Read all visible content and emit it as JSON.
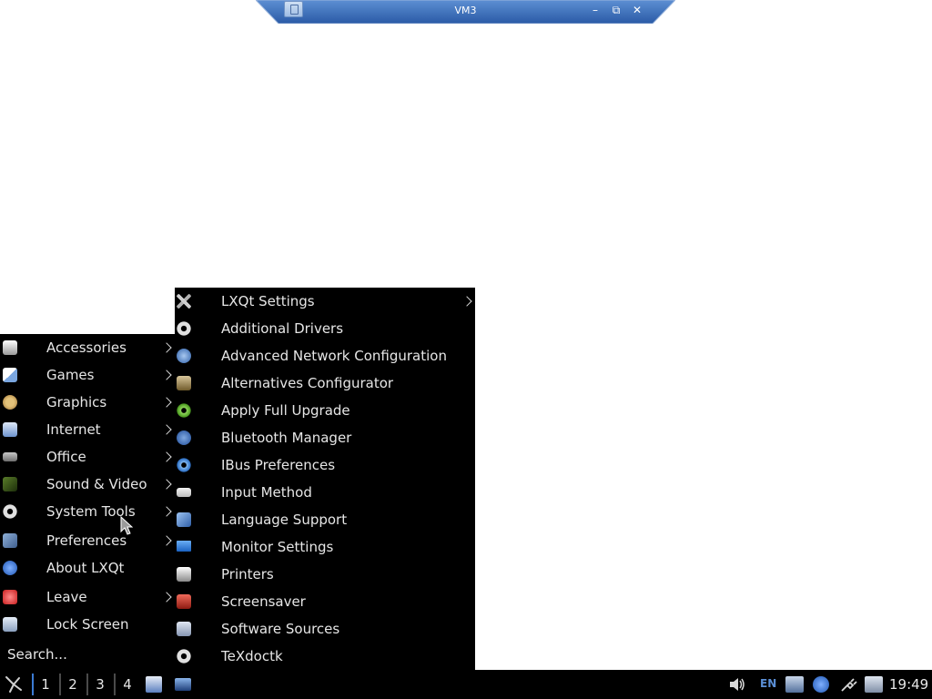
{
  "remote_bar": {
    "title": "VM3",
    "minimize": "–",
    "restore": "⧉",
    "close": "✕"
  },
  "main_menu": {
    "items": [
      {
        "label": "Accessories",
        "icon": "accessories-icon",
        "submenu": true
      },
      {
        "label": "Games",
        "icon": "games-icon",
        "submenu": true
      },
      {
        "label": "Graphics",
        "icon": "graphics-icon",
        "submenu": true
      },
      {
        "label": "Internet",
        "icon": "internet-icon",
        "submenu": true
      },
      {
        "label": "Office",
        "icon": "office-icon",
        "submenu": true
      },
      {
        "label": "Sound & Video",
        "icon": "sound-video-icon",
        "submenu": true
      },
      {
        "label": "System Tools",
        "icon": "gear-icon",
        "submenu": true
      },
      {
        "label": "Preferences",
        "icon": "preferences-icon",
        "submenu": true
      },
      {
        "label": "About LXQt",
        "icon": "info-icon",
        "submenu": false
      },
      {
        "label": "Leave",
        "icon": "power-icon",
        "submenu": true
      },
      {
        "label": "Lock Screen",
        "icon": "lock-icon",
        "submenu": false
      }
    ],
    "search_placeholder": "Search..."
  },
  "sub_menu": {
    "items": [
      {
        "label": "LXQt Settings",
        "icon": "tools-icon",
        "submenu": true
      },
      {
        "label": "Additional Drivers",
        "icon": "gear-icon",
        "submenu": false
      },
      {
        "label": "Advanced Network Configuration",
        "icon": "network-icon",
        "submenu": false
      },
      {
        "label": "Alternatives Configurator",
        "icon": "alternatives-icon",
        "submenu": false
      },
      {
        "label": "Apply Full Upgrade",
        "icon": "upgrade-gear-icon",
        "submenu": false
      },
      {
        "label": "Bluetooth Manager",
        "icon": "bluetooth-icon",
        "submenu": false
      },
      {
        "label": "IBus Preferences",
        "icon": "ibus-gear-icon",
        "submenu": false
      },
      {
        "label": "Input Method",
        "icon": "keyboard-icon",
        "submenu": false
      },
      {
        "label": "Language Support",
        "icon": "language-icon",
        "submenu": false
      },
      {
        "label": "Monitor Settings",
        "icon": "monitor-icon",
        "submenu": false
      },
      {
        "label": "Printers",
        "icon": "printer-icon",
        "submenu": false
      },
      {
        "label": "Screensaver",
        "icon": "screensaver-icon",
        "submenu": false
      },
      {
        "label": "Software Sources",
        "icon": "software-sources-icon",
        "submenu": false
      },
      {
        "label": "TeXdoctk",
        "icon": "gear-icon",
        "submenu": false
      }
    ]
  },
  "taskbar": {
    "desktops": [
      "1",
      "2",
      "3",
      "4"
    ],
    "active_desktop": "1",
    "keyboard_layout": "EN",
    "clock": "19:49"
  },
  "colors": {
    "menu_bg": "#000000",
    "menu_text": "#e6e6e6",
    "accent": "#3b7bd4",
    "rd_bar": "#2f64b3"
  }
}
